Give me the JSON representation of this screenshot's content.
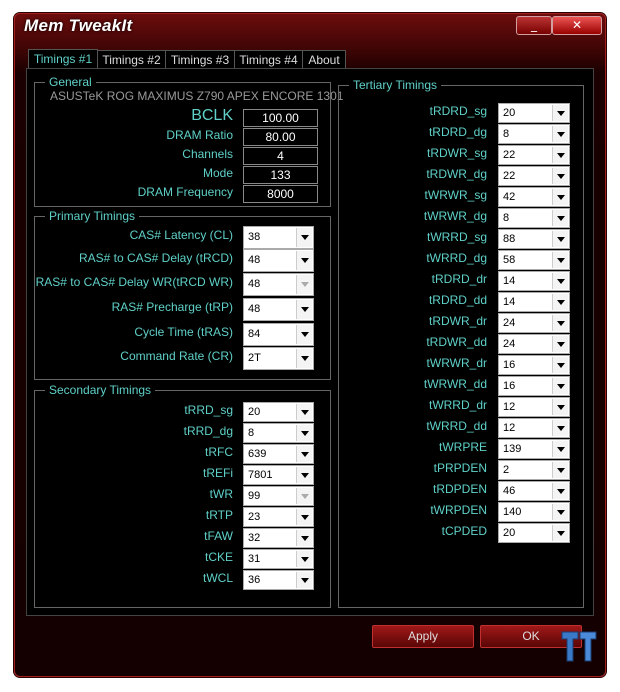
{
  "window": {
    "title": "Mem TweakIt",
    "minimize_label": "_",
    "close_label": "✕"
  },
  "tabs": [
    {
      "label": "Timings #1",
      "active": true
    },
    {
      "label": "Timings #2"
    },
    {
      "label": "Timings #3"
    },
    {
      "label": "Timings #4"
    },
    {
      "label": "About"
    }
  ],
  "general": {
    "title": "General",
    "board": "ASUSTeK ROG MAXIMUS Z790 APEX ENCORE 1301",
    "fields": [
      {
        "label": "BCLK",
        "value": "100.00"
      },
      {
        "label": "DRAM Ratio",
        "value": "80.00"
      },
      {
        "label": "Channels",
        "value": "4"
      },
      {
        "label": "Mode",
        "value": "133"
      },
      {
        "label": "DRAM Frequency",
        "value": "8000"
      }
    ]
  },
  "primary": {
    "title": "Primary Timings",
    "fields": [
      {
        "label": "CAS# Latency (CL)",
        "value": "38"
      },
      {
        "label": "RAS# to CAS# Delay (tRCD)",
        "value": "48"
      },
      {
        "label": "RAS# to CAS# Delay WR(tRCD WR)",
        "value": "48",
        "disabled": true
      },
      {
        "label": "RAS# Precharge (tRP)",
        "value": "48"
      },
      {
        "label": "Cycle Time (tRAS)",
        "value": "84"
      },
      {
        "label": "Command Rate (CR)",
        "value": "2T"
      }
    ]
  },
  "secondary": {
    "title": "Secondary Timings",
    "fields": [
      {
        "label": "tRRD_sg",
        "value": "20"
      },
      {
        "label": "tRRD_dg",
        "value": "8"
      },
      {
        "label": "tRFC",
        "value": "639"
      },
      {
        "label": "tREFi",
        "value": "7801"
      },
      {
        "label": "tWR",
        "value": "99",
        "disabled": true
      },
      {
        "label": "tRTP",
        "value": "23"
      },
      {
        "label": "tFAW",
        "value": "32"
      },
      {
        "label": "tCKE",
        "value": "31"
      },
      {
        "label": "tWCL",
        "value": "36"
      }
    ]
  },
  "tertiary": {
    "title": "Tertiary Timings",
    "fields": [
      {
        "label": "tRDRD_sg",
        "value": "20"
      },
      {
        "label": "tRDRD_dg",
        "value": "8"
      },
      {
        "label": "tRDWR_sg",
        "value": "22"
      },
      {
        "label": "tRDWR_dg",
        "value": "22"
      },
      {
        "label": "tWRWR_sg",
        "value": "42"
      },
      {
        "label": "tWRWR_dg",
        "value": "8"
      },
      {
        "label": "tWRRD_sg",
        "value": "88"
      },
      {
        "label": "tWRRD_dg",
        "value": "58"
      },
      {
        "label": "tRDRD_dr",
        "value": "14"
      },
      {
        "label": "tRDRD_dd",
        "value": "14"
      },
      {
        "label": "tRDWR_dr",
        "value": "24"
      },
      {
        "label": "tRDWR_dd",
        "value": "24"
      },
      {
        "label": "tWRWR_dr",
        "value": "16"
      },
      {
        "label": "tWRWR_dd",
        "value": "16"
      },
      {
        "label": "tWRRD_dr",
        "value": "12"
      },
      {
        "label": "tWRRD_dd",
        "value": "12"
      },
      {
        "label": "tWRPRE",
        "value": "139"
      },
      {
        "label": "tPRPDEN",
        "value": "2"
      },
      {
        "label": "tRDPDEN",
        "value": "46"
      },
      {
        "label": "tWRPDEN",
        "value": "140"
      },
      {
        "label": "tCPDED",
        "value": "20"
      }
    ]
  },
  "buttons": {
    "apply": "Apply",
    "ok": "OK"
  },
  "colors": {
    "label": "#5fd1c8",
    "accent": "#a01818"
  },
  "watermark": "TT"
}
